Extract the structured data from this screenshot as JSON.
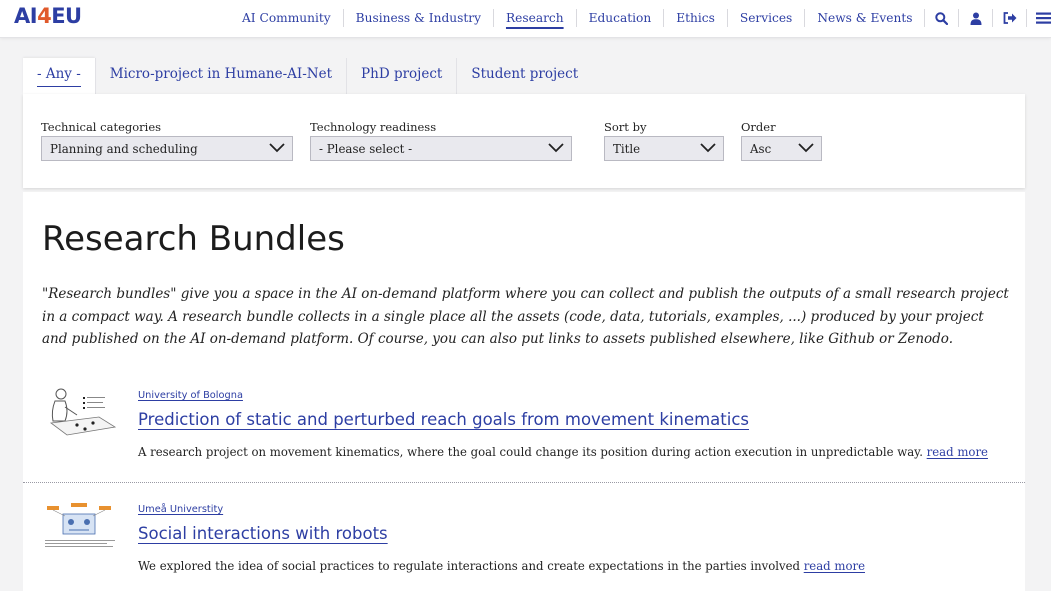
{
  "header": {
    "logo": {
      "ai": "AI",
      "four": "4",
      "eu": "EU"
    },
    "nav": [
      {
        "label": "AI Community"
      },
      {
        "label": "Business & Industry"
      },
      {
        "label": "Research"
      },
      {
        "label": "Education"
      },
      {
        "label": "Ethics"
      },
      {
        "label": "Services"
      },
      {
        "label": "News & Events"
      }
    ],
    "active_nav": "Research",
    "icons": [
      "search-icon",
      "user-icon",
      "logout-icon",
      "menu-icon"
    ]
  },
  "tabs": [
    {
      "label": "- Any -"
    },
    {
      "label": "Micro-project in Humane-AI-Net"
    },
    {
      "label": "PhD project"
    },
    {
      "label": "Student project"
    }
  ],
  "active_tab": "- Any -",
  "filters": {
    "technical_categories": {
      "label": "Technical categories",
      "value": "Planning and scheduling"
    },
    "technology_readiness": {
      "label": "Technology readiness",
      "value": "- Please select -"
    },
    "sort_by": {
      "label": "Sort by",
      "value": "Title"
    },
    "order": {
      "label": "Order",
      "value": "Asc"
    }
  },
  "main": {
    "title": "Research Bundles",
    "intro": "\"Research bundles\" give you a space in the AI on-demand platform where you can collect and publish the outputs of a small research project in a compact way. A research bundle collects in a single place all the assets (code, data, tutorials, examples, ...) produced by your project and published on the AI on-demand platform. Of course, you can also put links to assets published elsewhere, like Github or Zenodo."
  },
  "bundles": [
    {
      "organization": "University of Bologna",
      "title": "Prediction of static and perturbed reach goals from movement kinematics",
      "description": "A research project on movement kinematics, where the goal could change its position during action execution in unpredictable way.",
      "read_more": "read more"
    },
    {
      "organization": "Umeå Universtity",
      "title": "Social interactions with robots",
      "description": "We explored the idea of social practices to regulate interactions and create expectations in the parties involved",
      "read_more": "read more"
    }
  ],
  "colors": {
    "brand_blue": "#2d3ea3",
    "brand_orange": "#e0592b",
    "background": "#f3f3f4"
  }
}
